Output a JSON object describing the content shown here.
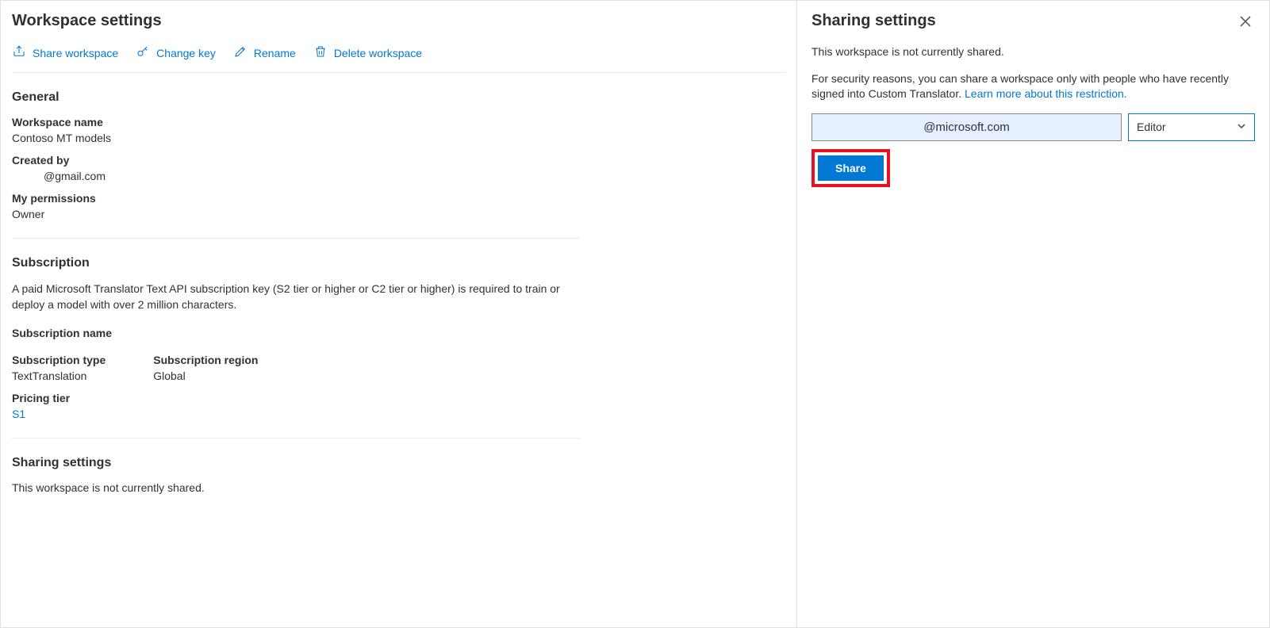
{
  "main": {
    "title": "Workspace settings",
    "toolbar": {
      "share": "Share workspace",
      "change_key": "Change key",
      "rename": "Rename",
      "delete": "Delete workspace"
    },
    "general": {
      "heading": "General",
      "workspace_name_label": "Workspace name",
      "workspace_name_value": "Contoso MT models",
      "created_by_label": "Created by",
      "created_by_value": "@gmail.com",
      "permissions_label": "My permissions",
      "permissions_value": "Owner"
    },
    "subscription": {
      "heading": "Subscription",
      "description": "A paid Microsoft Translator Text API subscription key (S2 tier or higher or C2 tier or higher) is required to train or deploy a model with over 2 million characters.",
      "name_label": "Subscription name",
      "type_label": "Subscription type",
      "type_value": "TextTranslation",
      "region_label": "Subscription region",
      "region_value": "Global",
      "tier_label": "Pricing tier",
      "tier_value": "S1"
    },
    "sharing": {
      "heading": "Sharing settings",
      "status": "This workspace is not currently shared."
    }
  },
  "panel": {
    "title": "Sharing settings",
    "status": "This workspace is not currently shared.",
    "security_prefix": "For security reasons, you can share a workspace only with people who have recently signed into Custom Translator. ",
    "learn_more": "Learn more about this restriction.",
    "email_value": "@microsoft.com",
    "role_selected": "Editor",
    "share_button": "Share"
  }
}
